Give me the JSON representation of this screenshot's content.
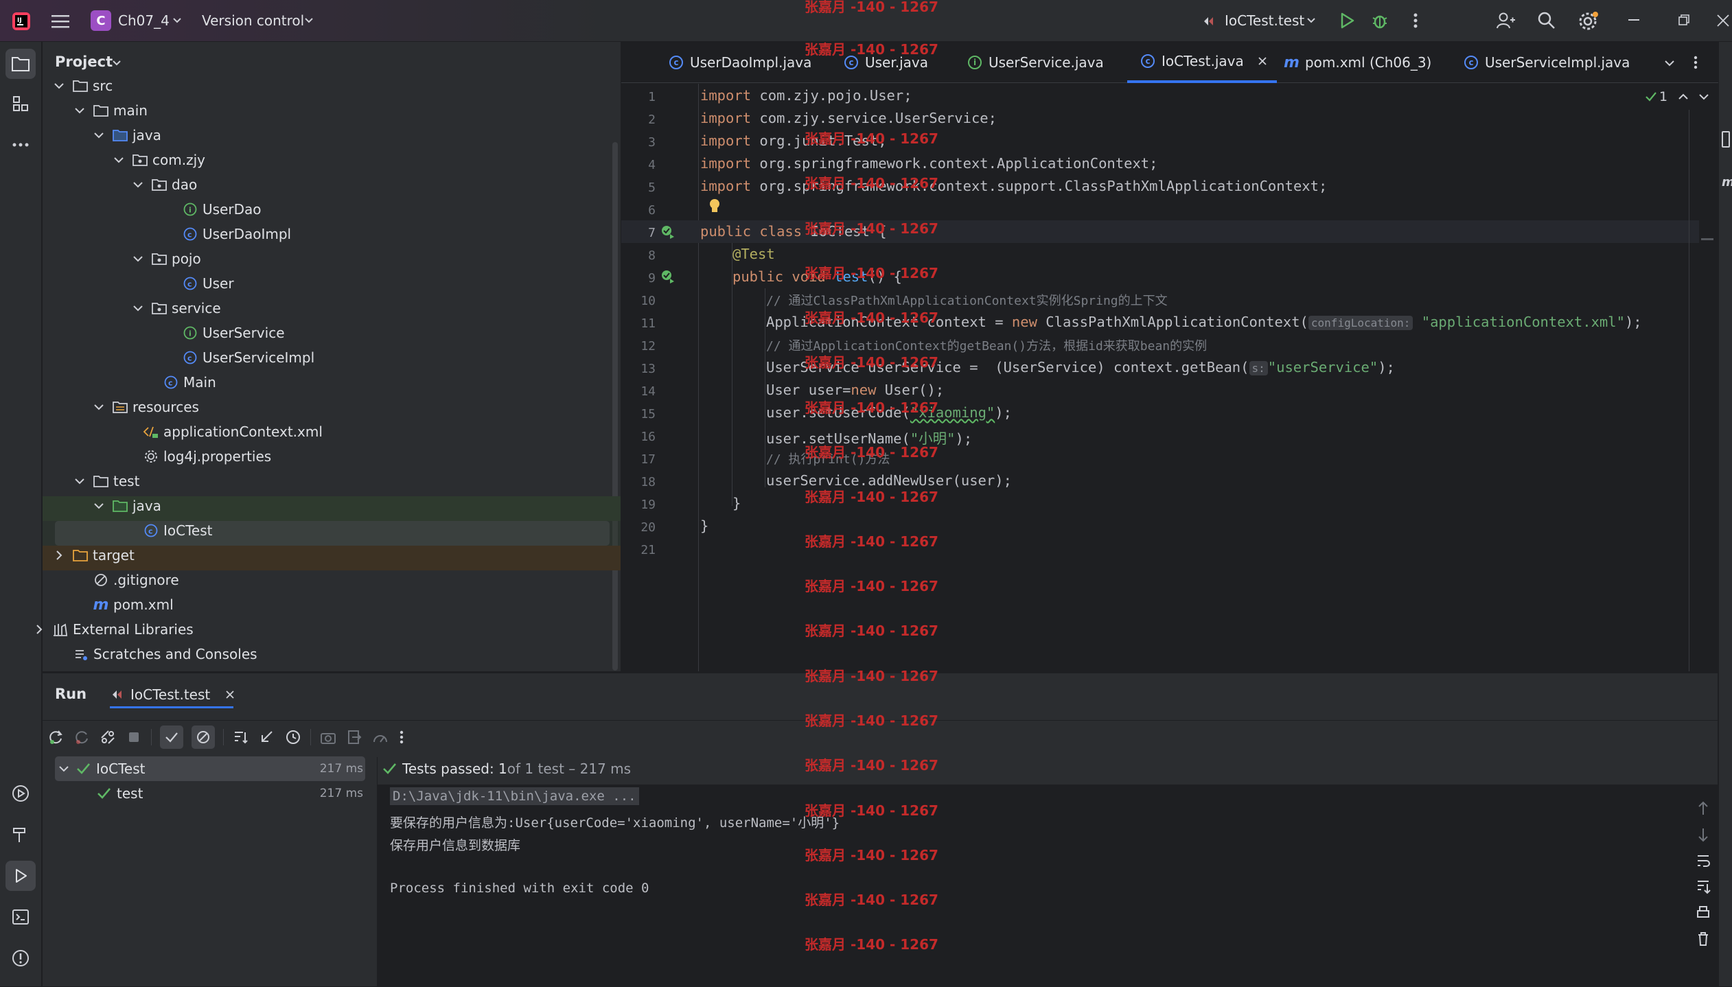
{
  "titlebar": {
    "project_badge": "C",
    "project_name": "Ch07_4",
    "version_control": "Version control",
    "run_config": "IoCTest.test"
  },
  "project_panel": {
    "title": "Project",
    "items": [
      {
        "label": "src"
      },
      {
        "label": "main"
      },
      {
        "label": "java"
      },
      {
        "label": "com.zjy"
      },
      {
        "label": "dao"
      },
      {
        "label": "UserDao"
      },
      {
        "label": "UserDaoImpl"
      },
      {
        "label": "pojo"
      },
      {
        "label": "User"
      },
      {
        "label": "service"
      },
      {
        "label": "UserService"
      },
      {
        "label": "UserServiceImpl"
      },
      {
        "label": "Main"
      },
      {
        "label": "resources"
      },
      {
        "label": "applicationContext.xml"
      },
      {
        "label": "log4j.properties"
      },
      {
        "label": "test"
      },
      {
        "label": "java"
      },
      {
        "label": "IoCTest"
      },
      {
        "label": "target"
      },
      {
        "label": ".gitignore"
      },
      {
        "label": "pom.xml"
      },
      {
        "label": "External Libraries"
      },
      {
        "label": "Scratches and Consoles"
      }
    ]
  },
  "editor": {
    "tabs": [
      {
        "label": "UserDaoImpl.java"
      },
      {
        "label": "User.java"
      },
      {
        "label": "UserService.java"
      },
      {
        "label": "IoCTest.java"
      },
      {
        "label": "pom.xml (Ch06_3)"
      },
      {
        "label": "UserServiceImpl.java"
      }
    ],
    "inspection_count": "1",
    "hint_config": "configLocation:",
    "hint_s": "s:",
    "lines": [
      "1",
      "2",
      "3",
      "4",
      "5",
      "6",
      "7",
      "8",
      "9",
      "10",
      "11",
      "12",
      "13",
      "14",
      "15",
      "16",
      "17",
      "18",
      "19",
      "20",
      "21"
    ],
    "code": {
      "l1_kw": "import",
      "l1": " com.zjy.pojo.User;",
      "l2_kw": "import",
      "l2": " com.zjy.service.UserService;",
      "l3_kw": "import",
      "l3": " org.junit.Test;",
      "l4_kw": "import",
      "l4": " org.springframework.context.ApplicationContext;",
      "l5_kw": "import",
      "l5": " org.springframework.context.support.ClassPathXmlApplicationContext;",
      "l7_kw": "public class",
      "l7": " IoCTest {",
      "l8": "@Test",
      "l9_kw": "public void",
      "l9_fn": " test",
      "l9": "() {",
      "l10": "// 通过ClassPathXmlApplicationContext实例化Spring的上下文",
      "l11_a": "ApplicationContext context = ",
      "l11_kw": "new",
      "l11_b": " ClassPathXmlApplicationContext(",
      "l11_str": "\"applicationContext.xml\"",
      "l11_c": ");",
      "l12": "// 通过ApplicationContext的getBean()方法，根据id来获取bean的实例",
      "l13_a": "UserService userService =  (UserService) context.getBean(",
      "l13_str": "\"userService\"",
      "l13_c": ");",
      "l14_a": "User user=",
      "l14_kw": "new",
      "l14_b": " User();",
      "l15_a": "user.setUserCode(",
      "l15_str": "\"xiaoming\"",
      "l15_c": ");",
      "l16_a": "user.setUserName(",
      "l16_str": "\"小明\"",
      "l16_c": ");",
      "l17": "// 执行print()方法",
      "l18": "userService.addNewUser(user);",
      "l19": "}",
      "l20": "}"
    }
  },
  "watermark": "张嘉月 -140 - 1267",
  "run_panel": {
    "tab_run": "Run",
    "tab_config": "IoCTest.test",
    "tests": [
      {
        "name": "IoCTest",
        "time": "217 ms"
      },
      {
        "name": "test",
        "time": "217 ms"
      }
    ],
    "status_bold": "Tests passed: 1",
    "status_rest": " of 1 test – 217 ms",
    "console": [
      "D:\\Java\\jdk-11\\bin\\java.exe ...",
      "要保存的用户信息为:User{userCode='xiaoming', userName='小明'}",
      "保存用户信息到数据库",
      "",
      "Process finished with exit code 0"
    ]
  },
  "colors": {
    "accent": "#3574f0",
    "success": "#5fb865",
    "keyword": "#cf8e6d",
    "string": "#6aab73",
    "watermark": "#c42a2a"
  }
}
